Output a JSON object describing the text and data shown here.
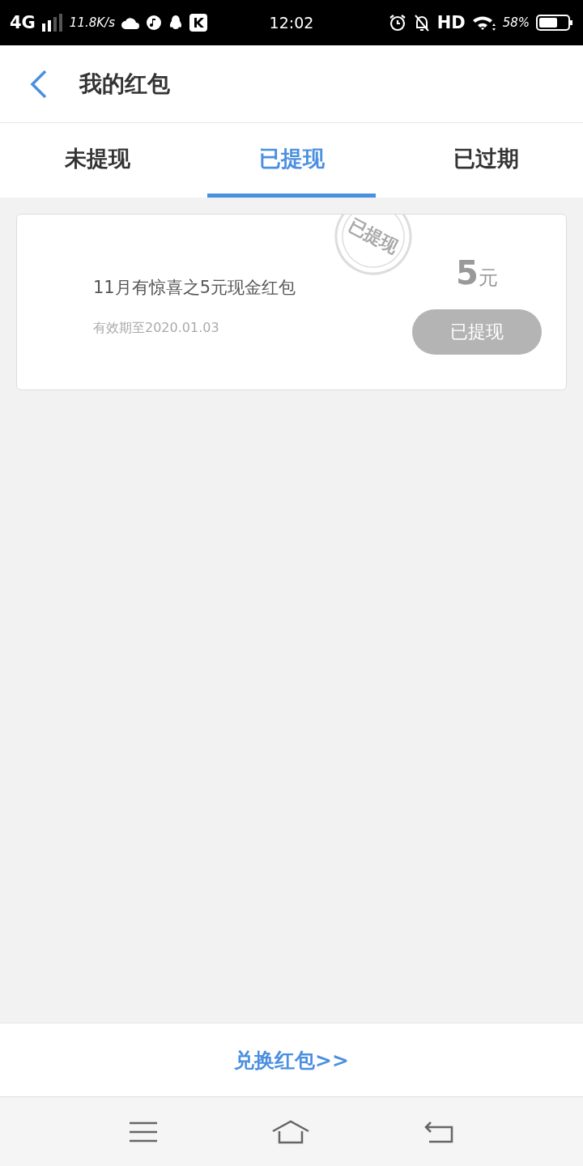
{
  "status_bar": {
    "network": "4G",
    "speed": "11.8K/s",
    "time": "12:02",
    "hd": "HD",
    "battery": "58%"
  },
  "header": {
    "title": "我的红包"
  },
  "tabs": [
    {
      "label": "未提现",
      "selected": false
    },
    {
      "label": "已提现",
      "selected": true
    },
    {
      "label": "已过期",
      "selected": false
    }
  ],
  "packets": [
    {
      "title": "11月有惊喜之5元现金红包",
      "expiry": "有效期至2020.01.03",
      "amount": "5",
      "unit": "元",
      "stamp": "已提现",
      "button": "已提现",
      "disabled": true
    }
  ],
  "footer": {
    "link": "兑换红包>>"
  }
}
